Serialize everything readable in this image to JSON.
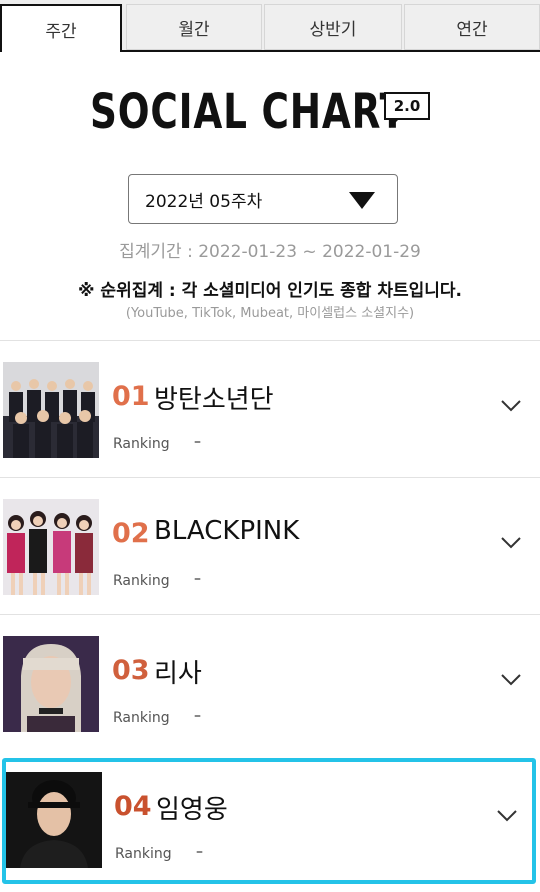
{
  "tabs": [
    "주간",
    "월간",
    "상반기",
    "연간"
  ],
  "header": {
    "title": "SOCIAL CHART",
    "badge": "2.0"
  },
  "selector": {
    "value": "2022년 05주차"
  },
  "period": "집계기간 : 2022-01-23 ~ 2022-01-29",
  "notice": "※ 순위집계 : 각 소셜미디어 인기도 종합 차트입니다.",
  "sources": "(YouTube, TikTok, Mubeat, 마이셀럽스 소셜지수)",
  "colors": {
    "rank": "#e0704b",
    "highlight": "#24c3e8",
    "active_tab_border": "#111111"
  },
  "items": [
    {
      "rank": "01",
      "name": "방탄소년단",
      "ranking_label": "Ranking",
      "ranking_value": "–"
    },
    {
      "rank": "02",
      "name": "BLACKPINK",
      "ranking_label": "Ranking",
      "ranking_value": "–"
    },
    {
      "rank": "03",
      "name": "리사",
      "ranking_label": "Ranking",
      "ranking_value": "–"
    },
    {
      "rank": "04",
      "name": "임영웅",
      "ranking_label": "Ranking",
      "ranking_value": "–"
    }
  ]
}
